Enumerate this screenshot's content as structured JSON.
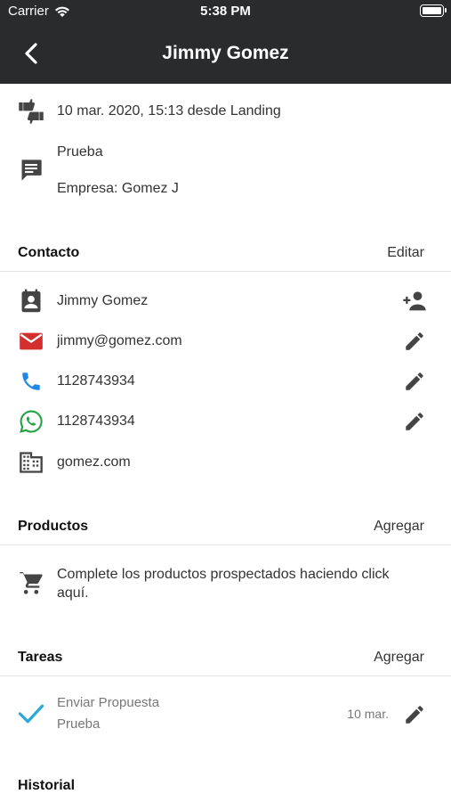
{
  "status": {
    "carrier": "Carrier",
    "time": "5:38 PM"
  },
  "nav": {
    "title": "Jimmy Gomez"
  },
  "lead": {
    "date_source": "10 mar. 2020, 15:13 desde Landing",
    "note_line1": "Prueba",
    "note_line2": "Empresa: Gomez J"
  },
  "contact": {
    "header": "Contacto",
    "action": "Editar",
    "name": "Jimmy Gomez",
    "email": "jimmy@gomez.com",
    "phone": "1128743934",
    "whatsapp": "1128743934",
    "website": "gomez.com"
  },
  "products": {
    "header": "Productos",
    "action": "Agregar",
    "empty_text": "Complete los productos prospectados haciendo click aquí."
  },
  "tasks": {
    "header": "Tareas",
    "action": "Agregar",
    "items": [
      {
        "title": "Enviar Propuesta",
        "subtitle": "Prueba",
        "date": "10 mar."
      }
    ]
  },
  "history": {
    "header": "Historial"
  },
  "colors": {
    "nav_bg": "#2a2b2d",
    "email_icon": "#d32f2f",
    "phone_icon": "#1e88e5",
    "whatsapp_icon": "#25a244",
    "check_icon": "#2aa9d6"
  }
}
